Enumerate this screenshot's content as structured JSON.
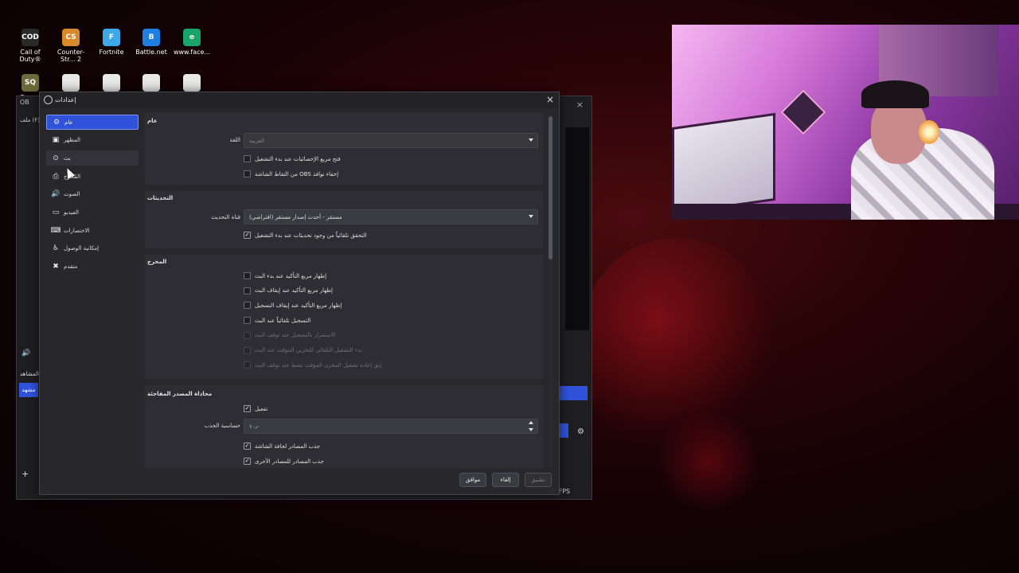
{
  "desktop": {
    "icons": [
      {
        "label": "Call of Duty®",
        "icon": "call-of-duty-icon",
        "color": "#2a2a2a",
        "glyph": "COD"
      },
      {
        "label": "Counter-Str... 2",
        "icon": "counter-strike-icon",
        "color": "#d88a2a",
        "glyph": "CS"
      },
      {
        "label": "Fortnite",
        "icon": "fortnite-icon",
        "color": "#3fa8e8",
        "glyph": "F"
      },
      {
        "label": "Battle.net",
        "icon": "battlenet-icon",
        "color": "#1d7fe0",
        "glyph": "B"
      },
      {
        "label": "www.face...",
        "icon": "edge-icon",
        "color": "#1aa46a",
        "glyph": "e"
      },
      {
        "label": "Squad",
        "icon": "squad-icon",
        "color": "#6a6a3a",
        "glyph": "SQ"
      },
      {
        "label": "",
        "icon": "file-icon",
        "color": "#e8e8e8",
        "glyph": ""
      },
      {
        "label": "",
        "icon": "file-icon",
        "color": "#e8e8e8",
        "glyph": ""
      },
      {
        "label": "",
        "icon": "file-icon",
        "color": "#e8e8e8",
        "glyph": ""
      },
      {
        "label": "",
        "icon": "file-icon",
        "color": "#e8e8e8",
        "glyph": ""
      }
    ]
  },
  "obs_main": {
    "title": "OB",
    "menu_file": "ملف (F)",
    "scene_button": "مشهد",
    "scenes_header": "المشاهد",
    "fps": "0 FPS"
  },
  "dialog": {
    "title": "إعدادات",
    "close": "×",
    "sidebar": [
      {
        "label": "عام",
        "icon": "gear-icon",
        "glyph": "⚙",
        "active": true
      },
      {
        "label": "المظهر",
        "icon": "appearance-icon",
        "glyph": "▣",
        "active": false
      },
      {
        "label": "بث",
        "icon": "broadcast-icon",
        "glyph": "⊙",
        "active": false
      },
      {
        "label": "المُخرج",
        "icon": "output-icon",
        "glyph": "⎙",
        "active": false
      },
      {
        "label": "الصوت",
        "icon": "speaker-icon",
        "glyph": "🔊",
        "active": false
      },
      {
        "label": "الفيديو",
        "icon": "monitor-icon",
        "glyph": "▭",
        "active": false
      },
      {
        "label": "الاختصارات",
        "icon": "keyboard-icon",
        "glyph": "⌨",
        "active": false
      },
      {
        "label": "إمكانية الوصول",
        "icon": "accessibility-icon",
        "glyph": "♿",
        "active": false
      },
      {
        "label": "متقدم",
        "icon": "wrench-icon",
        "glyph": "✖",
        "active": false
      }
    ],
    "general": {
      "title": "عام",
      "language_label": "اللغة",
      "language_value": "العربية",
      "check_stats": "فتح مربع الإحصائيات عند بدء التشغيل",
      "check_hide_obs": "من التقاط الشاشة OBS إخفاء نوافذ"
    },
    "updates": {
      "title": "التحديثات",
      "channel_label": "قناة التحديث",
      "channel_value": "مستقر - أحدث إصدار مستقر (افتراضي)",
      "check_auto_update": "التحقق تلقائياً من وجود تحديثات عند بدء التشغيل"
    },
    "output": {
      "title": "المخرج",
      "checks": [
        {
          "label": "إظهار مربع التأكيد عند بدء البث",
          "checked": false,
          "disabled": false
        },
        {
          "label": "إظهار مربع التأكيد عند إيقاف البث",
          "checked": false,
          "disabled": false
        },
        {
          "label": "إظهار مربع التأكيد عند إيقاف التسجيل",
          "checked": false,
          "disabled": false
        },
        {
          "label": "التسجيل تلقائياً عند البث",
          "checked": false,
          "disabled": false
        },
        {
          "label": "الاستمرار بالتسجيل عند توقف البث",
          "checked": false,
          "disabled": true
        },
        {
          "label": "بدء التشغيل التلقائي للتخزين المؤقت عند البث",
          "checked": false,
          "disabled": true
        },
        {
          "label": "إبق إعادة تشغيل المخزن المؤقت نشط عند توقف البث",
          "checked": false,
          "disabled": true
        }
      ]
    },
    "snapping": {
      "title": "محاذاة المصدر المفاجئة",
      "enable": "تفعيل",
      "sensitivity_label": "حساسية الجذب",
      "sensitivity_value": "١٠٫٠",
      "snap_screen": "جذب المصادر لحافة الشاشة",
      "snap_sources": "جذب المصادر للمصادر الأخرى"
    },
    "buttons": {
      "ok": "موافق",
      "cancel": "إلغاء",
      "apply": "تطبيق"
    }
  },
  "colors": {
    "accent": "#2f52d8",
    "dialog_bg": "#27272c",
    "group_bg": "#2d2d33"
  }
}
